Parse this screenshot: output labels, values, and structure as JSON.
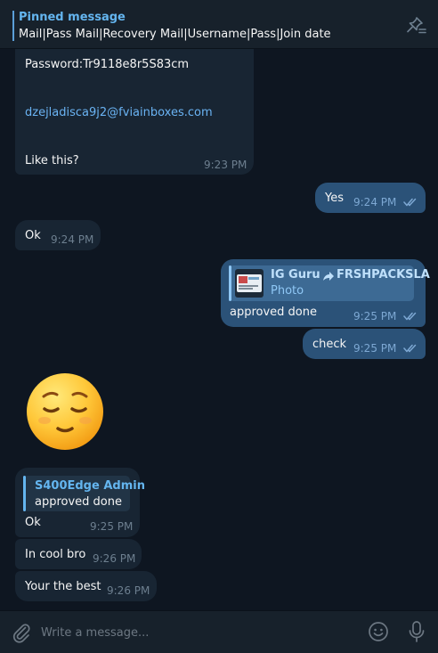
{
  "pinned": {
    "title": "Pinned message",
    "text": "Mail|Pass Mail|Recovery Mail|Username|Pass|Join date"
  },
  "messages": {
    "m1": {
      "password": "Password:Tr9118e8r5S83cm",
      "email": "dzejladisca9j2@fviainboxes.com",
      "text": "Like this?",
      "time": "9:23 PM"
    },
    "m2": {
      "text": "Yes",
      "time": "9:24 PM"
    },
    "m3": {
      "text": "Ok",
      "time": "9:24 PM"
    },
    "m4": {
      "reply_name": "IG Guru",
      "reply_forward": "FRSHPACKSLA",
      "reply_type": "Photo",
      "text": "approved done",
      "time": "9:25 PM"
    },
    "m5": {
      "text": "check",
      "time": "9:25 PM"
    },
    "m6": {
      "emoji": "😌"
    },
    "m7": {
      "reply_name": "S400Edge Admin",
      "reply_text": "approved done",
      "text": "Ok",
      "time": "9:25 PM"
    },
    "m8": {
      "text": "In cool bro",
      "time": "9:26 PM"
    },
    "m9": {
      "text": "Your the best",
      "time": "9:26 PM"
    }
  },
  "composer": {
    "placeholder": "Write a message..."
  },
  "colors": {
    "background": "#0e1621",
    "incoming": "#182533",
    "outgoing": "#2b5278",
    "accent": "#64b5ef"
  },
  "icons": {
    "unpin": "unpin-icon",
    "attach": "paperclip-icon",
    "emoji": "smiley-icon",
    "mic": "microphone-icon",
    "read": "double-check-icon",
    "forward": "forward-arrow-icon"
  }
}
